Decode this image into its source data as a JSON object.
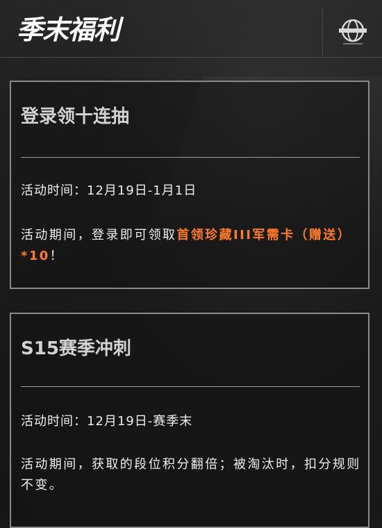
{
  "header": {
    "title": "季末福利"
  },
  "cards": [
    {
      "title": "登录领十连抽",
      "time_label": "活动时间：",
      "time_value": "12月19日-1月1日",
      "desc_prefix": "活动期间，登录即可领取",
      "desc_highlight": "首领珍藏III军需卡（赠送）*10",
      "desc_suffix": "！"
    },
    {
      "title": "S15赛季冲刺",
      "time_label": "活动时间：",
      "time_value": "12月19日-赛季末",
      "desc": "活动期间，获取的段位积分翻倍；被淘汰时，扣分规则不变。"
    }
  ],
  "colors": {
    "accent": "#ff7a2a",
    "background": "#1a1a1a",
    "card_border": "#8a8a8a"
  },
  "icons": {
    "header_logo": "globe-emblem-icon"
  }
}
